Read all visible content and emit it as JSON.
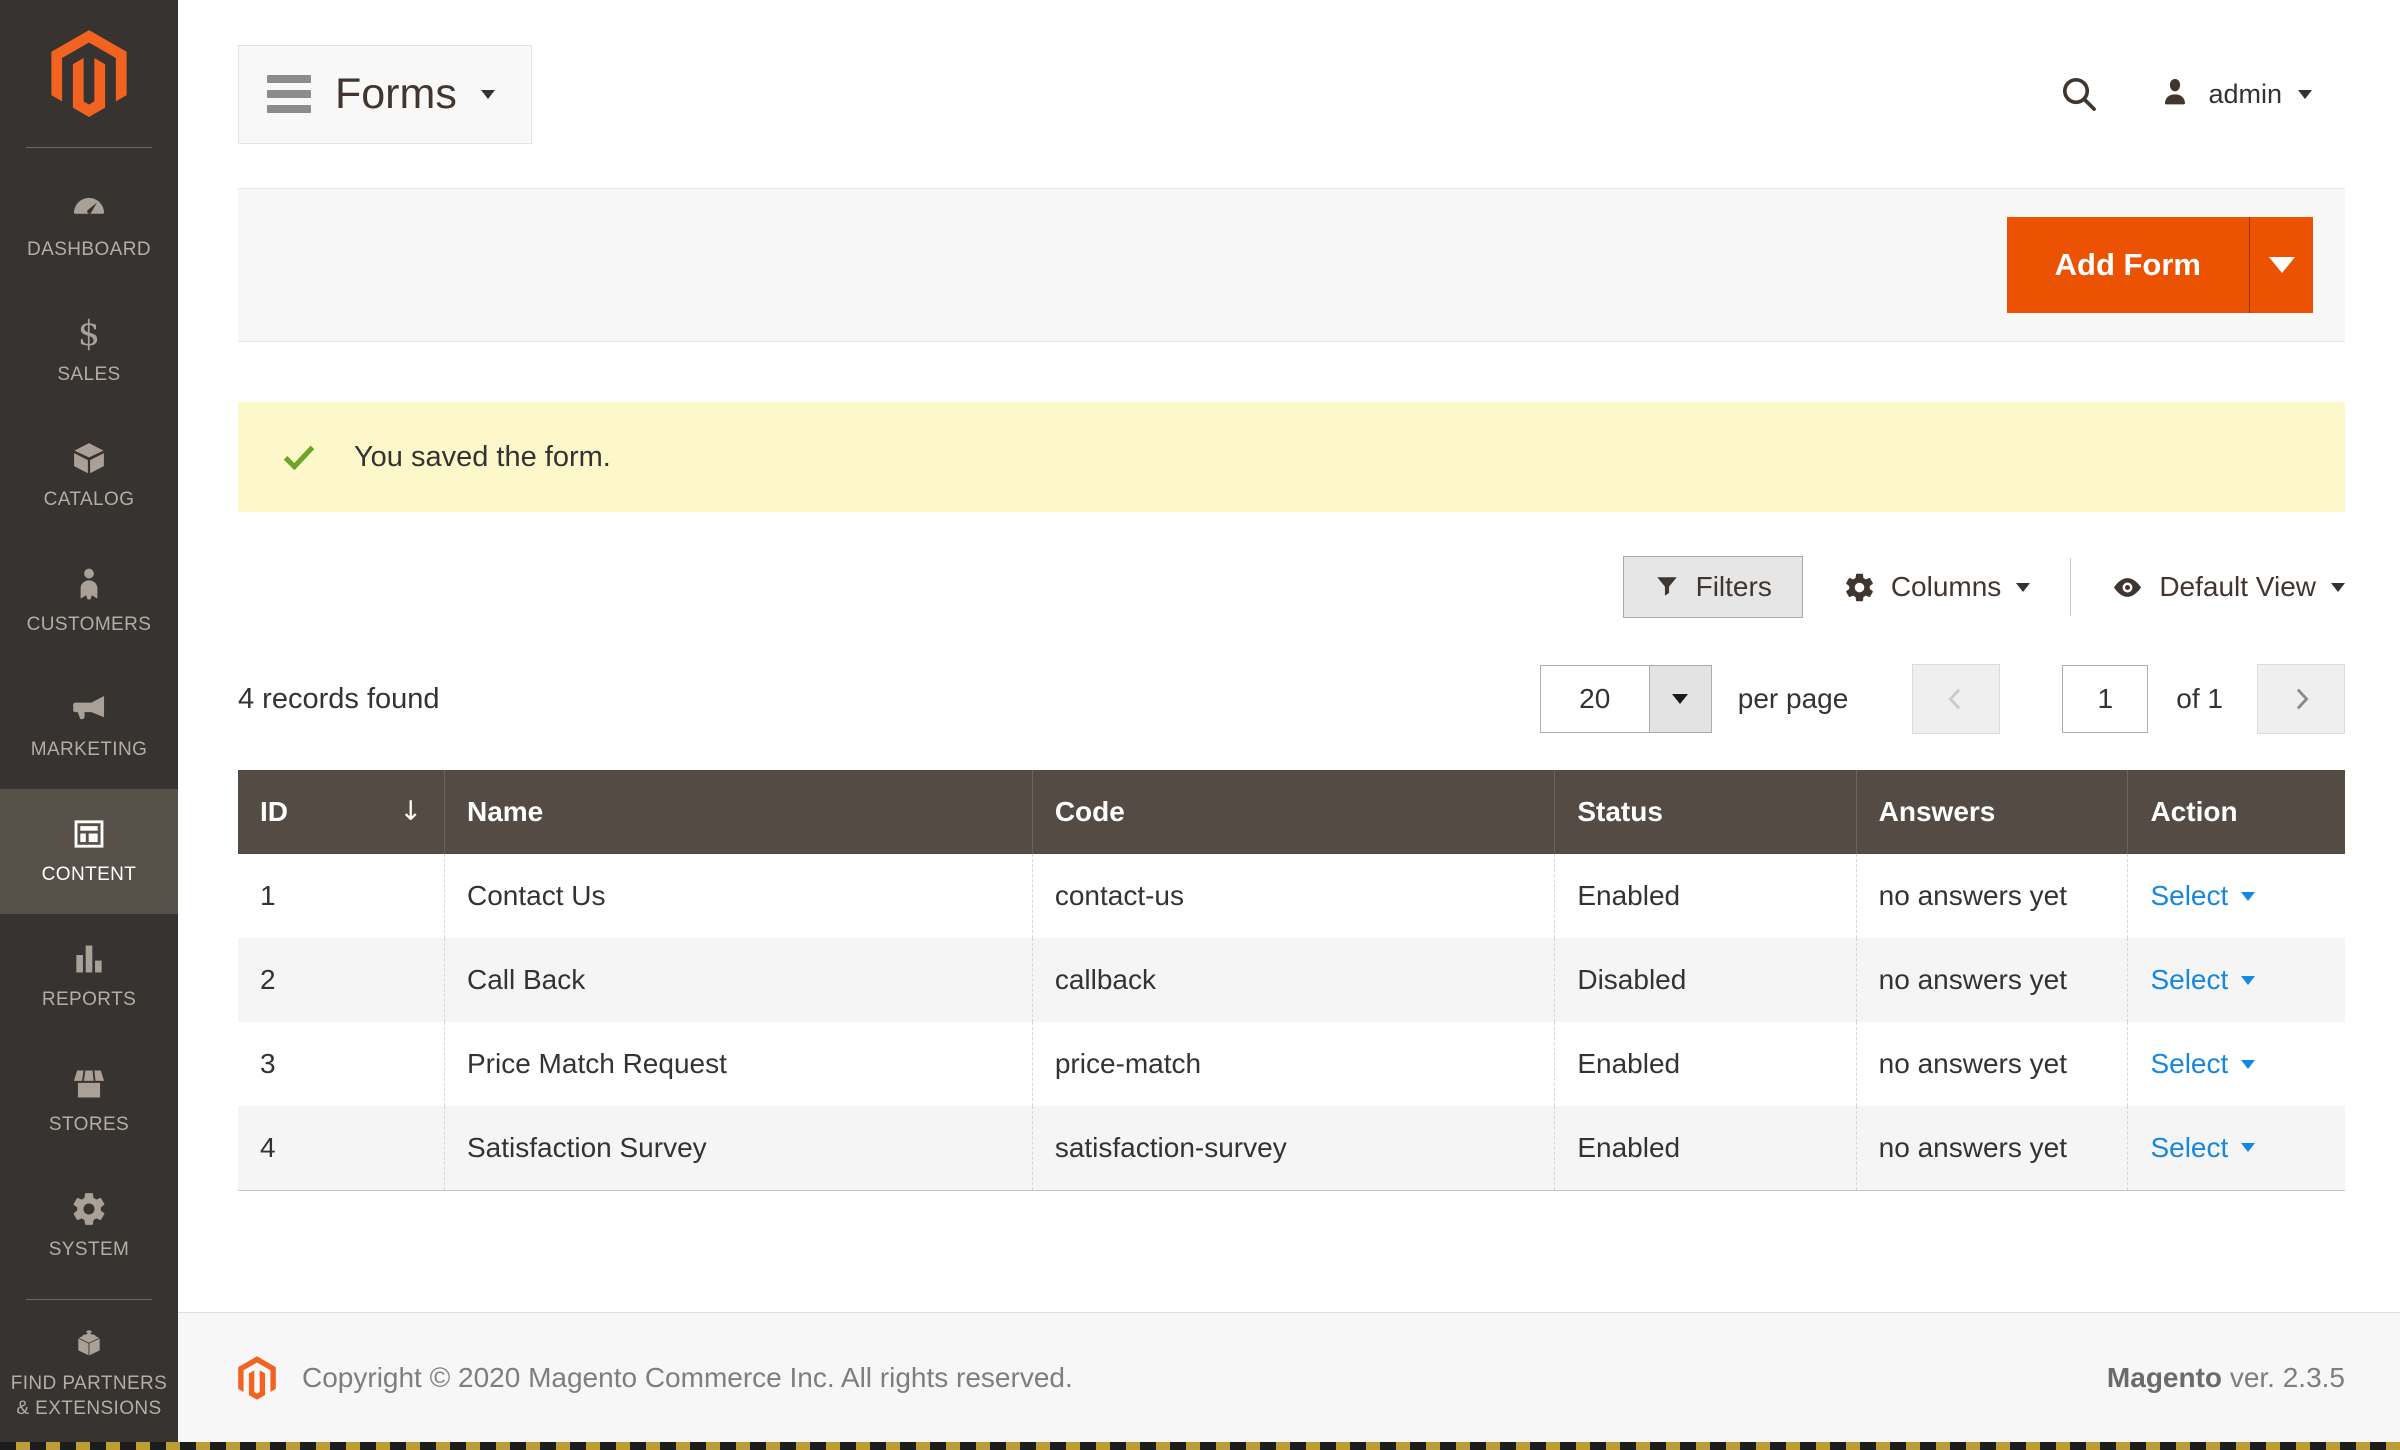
{
  "sidebar": {
    "items": [
      {
        "id": "dashboard",
        "label": "DASHBOARD",
        "icon": "dashboard-icon",
        "active": false
      },
      {
        "id": "sales",
        "label": "SALES",
        "icon": "sales-icon",
        "active": false
      },
      {
        "id": "catalog",
        "label": "CATALOG",
        "icon": "catalog-icon",
        "active": false
      },
      {
        "id": "customers",
        "label": "CUSTOMERS",
        "icon": "customers-icon",
        "active": false
      },
      {
        "id": "marketing",
        "label": "MARKETING",
        "icon": "marketing-icon",
        "active": false
      },
      {
        "id": "content",
        "label": "CONTENT",
        "icon": "content-icon",
        "active": true
      },
      {
        "id": "reports",
        "label": "REPORTS",
        "icon": "reports-icon",
        "active": false
      },
      {
        "id": "stores",
        "label": "STORES",
        "icon": "stores-icon",
        "active": false
      },
      {
        "id": "system",
        "label": "SYSTEM",
        "icon": "system-icon",
        "active": false
      },
      {
        "id": "find-partners",
        "label": "FIND PARTNERS & EXTENSIONS",
        "icon": "partners-icon",
        "active": false,
        "divider_before": true
      }
    ]
  },
  "header": {
    "title": "Forms",
    "user_name": "admin"
  },
  "page_actions": {
    "add_form_label": "Add Form"
  },
  "message": {
    "success_text": "You saved the form."
  },
  "grid_controls": {
    "filters_label": "Filters",
    "columns_label": "Columns",
    "view_label": "Default View"
  },
  "records_bar": {
    "summary": "4 records found",
    "per_page_value": "20",
    "per_page_label": "per page",
    "page_value": "1",
    "page_total_label": "of 1"
  },
  "table": {
    "columns": [
      "ID",
      "Name",
      "Code",
      "Status",
      "Answers",
      "Action"
    ],
    "sort_indicator": "↓",
    "rows": [
      {
        "id": "1",
        "name": "Contact Us",
        "code": "contact-us",
        "status": "Enabled",
        "answers": "no answers yet",
        "action": "Select"
      },
      {
        "id": "2",
        "name": "Call Back",
        "code": "callback",
        "status": "Disabled",
        "answers": "no answers yet",
        "action": "Select"
      },
      {
        "id": "3",
        "name": "Price Match Request",
        "code": "price-match",
        "status": "Enabled",
        "answers": "no answers yet",
        "action": "Select"
      },
      {
        "id": "4",
        "name": "Satisfaction Survey",
        "code": "satisfaction-survey",
        "status": "Enabled",
        "answers": "no answers yet",
        "action": "Select"
      }
    ]
  },
  "footer": {
    "copyright": "Copyright © 2020 Magento Commerce Inc. All rights reserved.",
    "brand": "Magento",
    "version": "ver. 2.3.5"
  },
  "colors": {
    "accent_orange": "#eb5202",
    "logo_orange": "#f26322",
    "link_blue": "#1787e0",
    "success_green": "#6da528",
    "sidebar_bg": "#373330",
    "table_header_bg": "#544c44",
    "message_bg": "#fdf8c9"
  }
}
